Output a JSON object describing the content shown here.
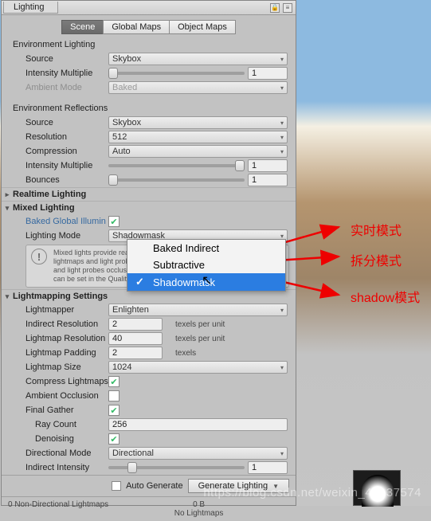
{
  "window": {
    "title": "Lighting"
  },
  "tabs": {
    "scene": "Scene",
    "globalMaps": "Global Maps",
    "objectMaps": "Object Maps"
  },
  "envLighting": {
    "header": "Environment Lighting",
    "source_label": "Source",
    "source_value": "Skybox",
    "intensity_label": "Intensity Multiplie",
    "intensity_value": "1",
    "ambient_label": "Ambient Mode",
    "ambient_value": "Baked"
  },
  "envReflections": {
    "header": "Environment Reflections",
    "source_label": "Source",
    "source_value": "Skybox",
    "resolution_label": "Resolution",
    "resolution_value": "512",
    "compression_label": "Compression",
    "compression_value": "Auto",
    "intensity_label": "Intensity Multiplie",
    "intensity_value": "1",
    "bounces_label": "Bounces",
    "bounces_value": "1"
  },
  "realtime": {
    "header": "Realtime Lighting"
  },
  "mixed": {
    "header": "Mixed Lighting",
    "bgi_label": "Baked Global Illumin",
    "mode_label": "Lighting Mode",
    "mode_value": "Shadowmask",
    "info": "Mixed lights provide realtime direct lighting. Indirect light gets baked into lightmaps and light probes. Shadows are handled with the Shadowmask and light probes occlusion. The Shadowmask Mode used at run time can be set in the Quality Settings panel.",
    "menu": {
      "baked_indirect": "Baked Indirect",
      "subtractive": "Subtractive",
      "shadowmask": "Shadowmask"
    }
  },
  "lm": {
    "header": "Lightmapping Settings",
    "lightmapper_label": "Lightmapper",
    "lightmapper_value": "Enlighten",
    "indirect_res_label": "Indirect Resolution",
    "indirect_res_value": "2",
    "texels_unit": "texels per unit",
    "lightmap_res_label": "Lightmap Resolution",
    "lightmap_res_value": "40",
    "padding_label": "Lightmap Padding",
    "padding_value": "2",
    "texels": "texels",
    "size_label": "Lightmap Size",
    "size_value": "1024",
    "compress_label": "Compress Lightmaps",
    "ao_label": "Ambient Occlusion",
    "final_gather_label": "Final Gather",
    "ray_count_label": "Ray Count",
    "ray_count_value": "256",
    "denoise_label": "Denoising",
    "dir_mode_label": "Directional Mode",
    "dir_mode_value": "Directional",
    "indirect_int_label": "Indirect Intensity",
    "indirect_int_value": "1"
  },
  "footer": {
    "auto_label": "Auto Generate",
    "generate_label": "Generate Lighting"
  },
  "status": {
    "left": "0 Non-Directional Lightmaps",
    "mid": "0 B",
    "right": "No Lightmaps"
  },
  "annotations": {
    "a1": "实时模式",
    "a2": "拆分模式",
    "a3": "shadow模式"
  },
  "watermark": "https://blog.csdn.net/weixin_42137574"
}
